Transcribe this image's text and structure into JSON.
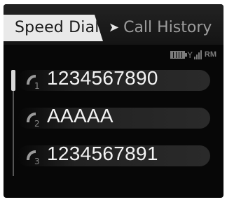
{
  "tabs": {
    "active": "Speed Dial",
    "next": "Call History"
  },
  "status": {
    "battery_icon": "battery-icon",
    "signal_icon": "signal-bars-icon",
    "roaming": "RM"
  },
  "speed_dial": [
    {
      "index": "1",
      "label": "1234567890"
    },
    {
      "index": "2",
      "label": "AAAAA"
    },
    {
      "index": "3",
      "label": "1234567891"
    }
  ],
  "colors": {
    "background": "#070707",
    "active_tab": "#e9e9e9",
    "text": "#f3f3f3",
    "muted": "#9c9c9c"
  }
}
